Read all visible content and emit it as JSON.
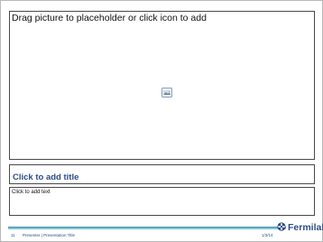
{
  "slide": {
    "picture_placeholder": {
      "prompt": "Drag picture to placeholder or click icon to add",
      "icon": "insert-picture-icon"
    },
    "title_placeholder": {
      "prompt": "Click to add title"
    },
    "text_placeholder": {
      "prompt": "Click to add text"
    }
  },
  "footer": {
    "page_number": "11",
    "presenter": "Presenter | Presentation Title",
    "date": "1/3/14",
    "logo_text": "Fermilab",
    "logo_icon": "fermilab-logo-icon"
  },
  "colors": {
    "title_text": "#2d4c86",
    "footer_bar": "#7fc4d6",
    "footer_bar_dark": "#3f8ea5",
    "placeholder_border": "#4a4a4a"
  }
}
